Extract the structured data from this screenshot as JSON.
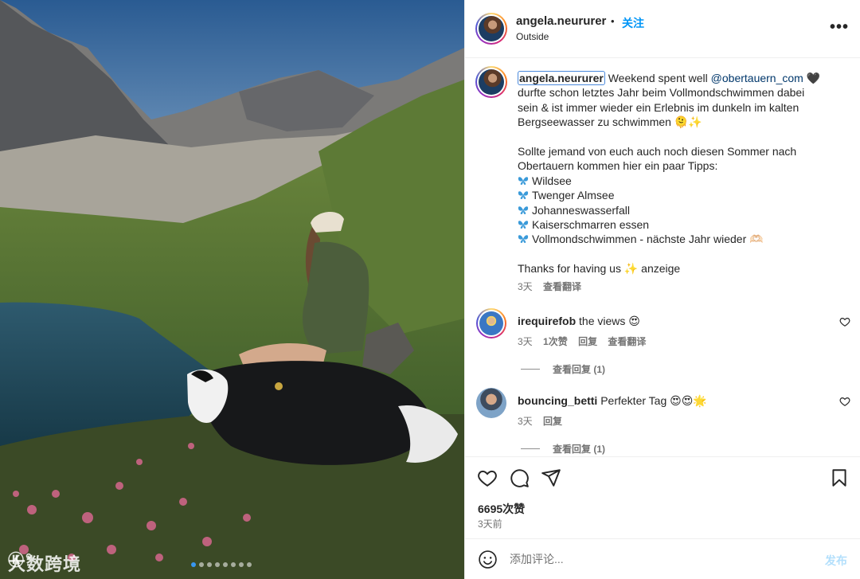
{
  "colors": {
    "accent": "#0095f6",
    "mention": "#00376b",
    "muted": "#737373",
    "text": "#262626"
  },
  "photo": {
    "alt_icon": "mountain-lake-photo",
    "watermark": "大数跨境",
    "carousel_count": 8,
    "carousel_active": 0
  },
  "header": {
    "username": "angela.neururer",
    "separator": "•",
    "follow_label": "关注",
    "location": "Outside",
    "more_icon": "more-horizontal-icon",
    "more_label": "•••"
  },
  "caption": {
    "username": "angela.neururer",
    "lines": [
      {
        "pre": " Weekend spent well ",
        "mention": "@obertauern_com",
        "post": " 🖤"
      },
      {
        "text": "durfte schon letztes Jahr beim Vollmondschwimmen dabei"
      },
      {
        "text": "sein & ist immer wieder ein Erlebnis im dunkeln im kalten"
      },
      {
        "text": "Bergseewasser zu schwimmen 🫠✨"
      },
      {
        "text": ""
      },
      {
        "text": "Sollte jemand von euch auch noch diesen Sommer nach"
      },
      {
        "text": "Obertauern kommen hier ein paar Tipps:"
      }
    ],
    "tips": [
      "Wildsee",
      "Twenger Almsee",
      "Johanneswasserfall",
      "Kaiserschmarren essen",
      "Vollmondschwimmen - nächste Jahr wieder 🫶🏻"
    ],
    "closing": "Thanks for having us ✨ anzeige",
    "time": "3天",
    "translate": "查看翻译"
  },
  "comments": [
    {
      "user": "irequirefob",
      "text": "the views 😍",
      "time": "3天",
      "likes": "1次赞",
      "reply": "回复",
      "translate": "查看翻译",
      "replies_label": "查看回复 (1)"
    },
    {
      "user": "bouncing_betti",
      "text": "Perfekter Tag 😍😍🌟",
      "time": "3天",
      "reply": "回复",
      "replies_label": "查看回复 (1)"
    }
  ],
  "actions": {
    "like_icon": "heart-icon",
    "comment_icon": "comment-icon",
    "share_icon": "share-icon",
    "save_icon": "bookmark-icon",
    "likes_count": "6695次赞",
    "posted_time": "3天前"
  },
  "add_comment": {
    "placeholder": "添加评论...",
    "post_label": "发布"
  }
}
